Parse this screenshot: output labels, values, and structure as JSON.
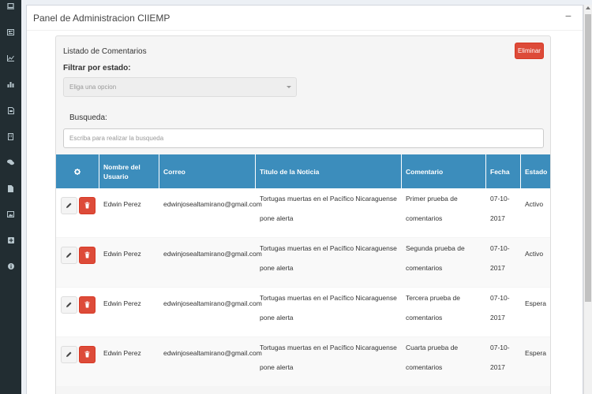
{
  "panel": {
    "title": "Panel de Administracion CIIEMP",
    "minimize_icon": "minus-icon"
  },
  "sidebar": {
    "icons": [
      "laptop-icon",
      "newspaper-icon",
      "line-chart-icon",
      "bar-chart-icon",
      "file-pdf-icon",
      "building-icon",
      "comments-icon",
      "file-icon",
      "image-icon",
      "plus-square-icon",
      "info-circle-icon"
    ]
  },
  "comments": {
    "title": "Listado de Comentarios",
    "delete_label": "Eliminar",
    "filter_label": "Filtrar por estado:",
    "filter_placeholder": "Eliga una opcion",
    "search_label": "Busqueda:",
    "search_placeholder": "Escriba para realizar la busqueda"
  },
  "table": {
    "header_icon": "gear-icon",
    "columns": [
      "Nombre del Usuario",
      "Correo",
      "Titulo de la Noticia",
      "Comentario",
      "Fecha",
      "Estado"
    ],
    "rows": [
      {
        "user": "Edwin Perez",
        "email": "edwinjosealtamirano@gmail.com",
        "title": "Tortugas muertas en el Pacífico Nicaraguense pone alerta",
        "comment": "Primer prueba de comentarios",
        "date": "07-10-2017",
        "status": "Activo"
      },
      {
        "user": "Edwin Perez",
        "email": "edwinjosealtamirano@gmail.com",
        "title": "Tortugas muertas en el Pacífico Nicaraguense pone alerta",
        "comment": "Segunda prueba de comentarios",
        "date": "07-10-2017",
        "status": "Activo"
      },
      {
        "user": "Edwin Perez",
        "email": "edwinjosealtamirano@gmail.com",
        "title": "Tortugas muertas en el Pacífico Nicaraguense pone alerta",
        "comment": "Tercera prueba de comentarios",
        "date": "07-10-2017",
        "status": "Espera"
      },
      {
        "user": "Edwin Perez",
        "email": "edwinjosealtamirano@gmail.com",
        "title": "Tortugas muertas en el Pacífico Nicaraguense pone alerta",
        "comment": "Cuarta prueba de comentarios",
        "date": "07-10-2017",
        "status": "Espera"
      }
    ]
  },
  "colors": {
    "primary": "#3c8dbc",
    "danger": "#dd4b39",
    "sidebar": "#222d32"
  }
}
